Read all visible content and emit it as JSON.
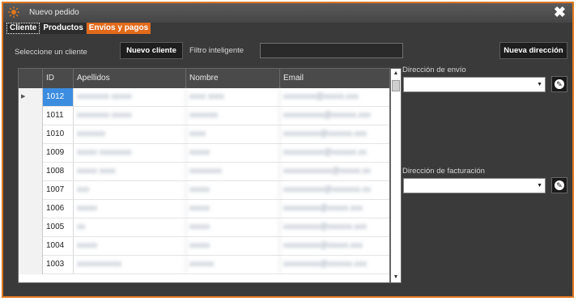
{
  "window": {
    "title": "Nuevo pedido",
    "close_glyph": "✖"
  },
  "tabs": [
    {
      "label": "Cliente"
    },
    {
      "label": "Productos"
    },
    {
      "label": "Envíos y pagos"
    }
  ],
  "toolbar": {
    "select_label": "Seleccione un cliente",
    "new_client_label": "Nuevo cliente",
    "filter_label": "Filtro inteligente",
    "filter_value": "",
    "new_address_label": "Nueva dirección"
  },
  "grid": {
    "headers": [
      "ID",
      "Apellidos",
      "Nombre",
      "Email"
    ],
    "rows": [
      {
        "id": "1012",
        "apellidos": "xxxxxxxx xxxxx",
        "nombre": "xxxx xxxx",
        "email": "xxxxxxxx@xxxxx.xxx"
      },
      {
        "id": "1011",
        "apellidos": "xxxxxxxx xxxxx",
        "nombre": "xxxxxxx",
        "email": "xxxxxxxxxx@xxxxxx.xxx"
      },
      {
        "id": "1010",
        "apellidos": "xxxxxxx",
        "nombre": "xxxx",
        "email": "xxxxxxxxx@xxxxxx.xxx"
      },
      {
        "id": "1009",
        "apellidos": "xxxxx xxxxxxxx",
        "nombre": "xxxxx",
        "email": "xxxxxxxxxx@xxxxxx.xx"
      },
      {
        "id": "1008",
        "apellidos": "xxxxx xxxx",
        "nombre": "xxxxxxxx",
        "email": "xxxxxxxxxxxx@xxxxx.xx"
      },
      {
        "id": "1007",
        "apellidos": "xxx",
        "nombre": "xxxxx",
        "email": "xxxxxxxxxx@xxxxxxx.xx"
      },
      {
        "id": "1006",
        "apellidos": "xxxxx",
        "nombre": "xxxxx",
        "email": "xxxxxxxxx@xxxxx.xxx"
      },
      {
        "id": "1005",
        "apellidos": "xx",
        "nombre": "xxxxx",
        "email": "xxxxxxxxx@xxxxxx.xxx"
      },
      {
        "id": "1004",
        "apellidos": "xxxxx",
        "nombre": "xxxxx",
        "email": "xxxxxxxxx@xxxxx.xxx"
      },
      {
        "id": "1003",
        "apellidos": "xxxxxxxxxxx",
        "nombre": "xxxxxx",
        "email": "xxxxxxxxx@xxxxxx.xxx"
      }
    ],
    "selected_row_index": 0
  },
  "shipping": {
    "label": "Dirección de envío",
    "value": ""
  },
  "billing": {
    "label": "Dirección de facturación",
    "value": ""
  },
  "colors": {
    "accent": "#e07820",
    "background": "#3a3a3a",
    "selection": "#3c8de0"
  },
  "icons": {
    "app": "sun-logo-icon",
    "close": "close-icon",
    "row_pointer": "row-pointer-icon",
    "edit": "edit-pencil-icon"
  }
}
